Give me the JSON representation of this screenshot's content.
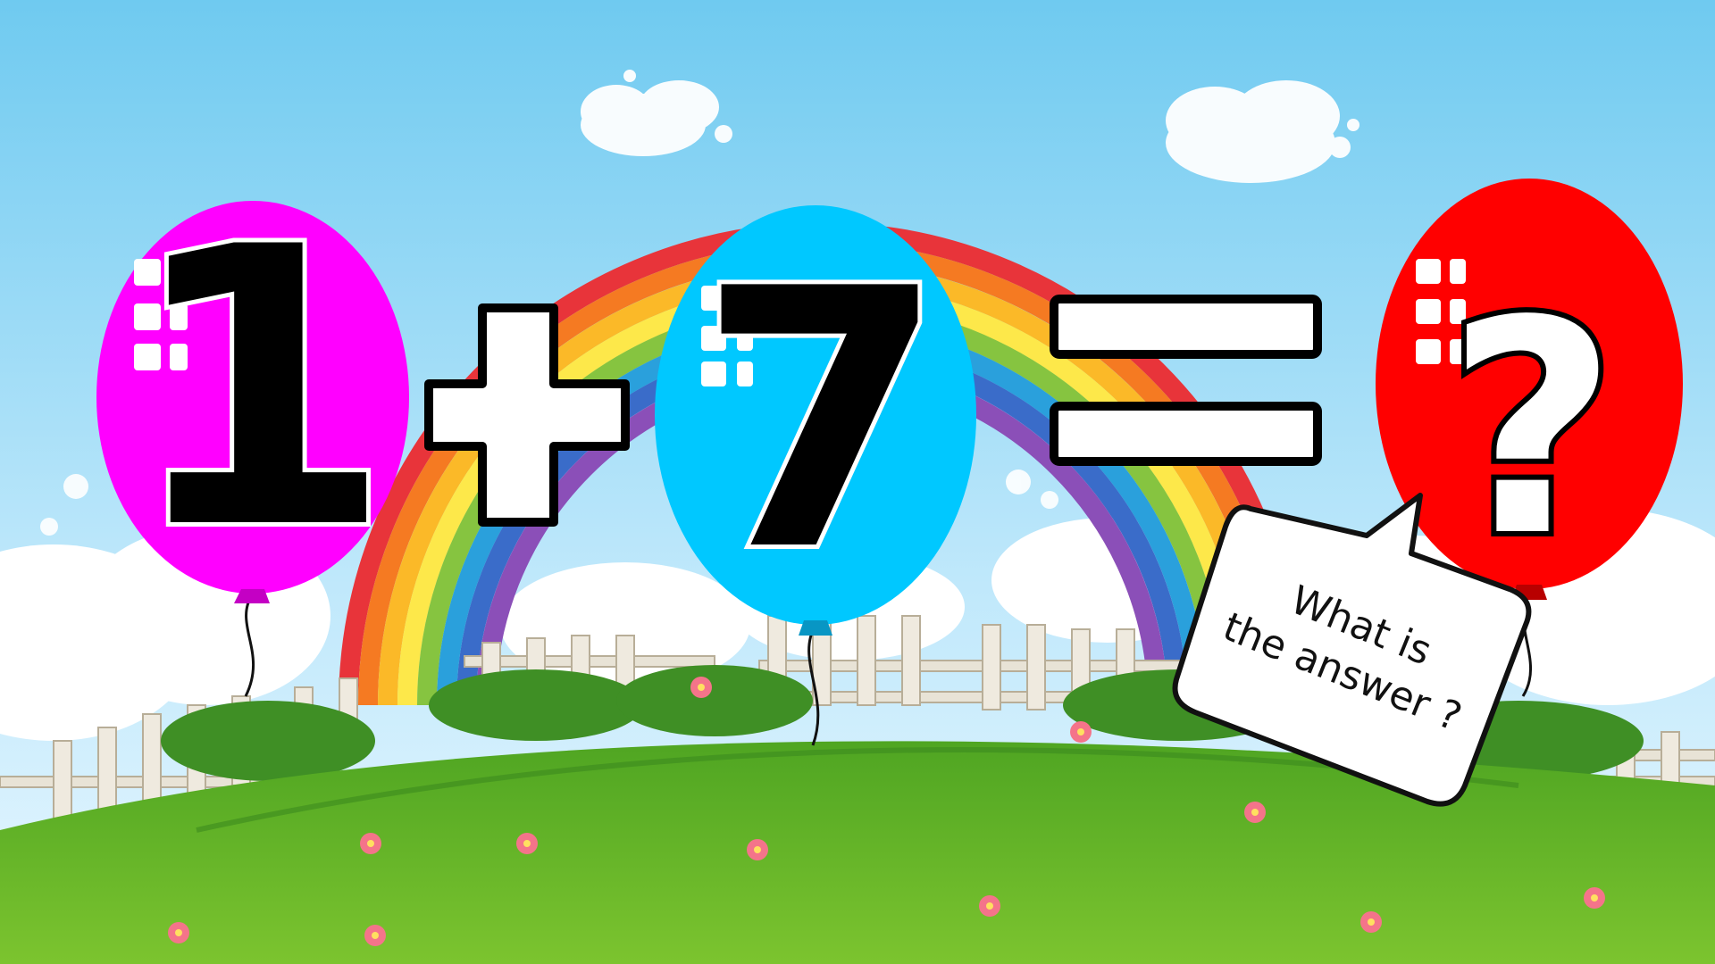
{
  "equation": {
    "first_number": "1",
    "operator": "+",
    "second_number": "7",
    "equals": "=",
    "answer": "?"
  },
  "speech_bubble": {
    "line1": "What is",
    "line2": "the answer ?"
  },
  "colors": {
    "sky": "#7fd0f2",
    "balloon_first": "#ff00ff",
    "balloon_second": "#00c8ff",
    "balloon_answer": "#ff0000",
    "grass": "#6fbf2a"
  },
  "icons": [
    "balloon-icon",
    "rainbow-icon",
    "cloud-icon",
    "fence-icon",
    "flower-icon",
    "speech-bubble-icon"
  ]
}
